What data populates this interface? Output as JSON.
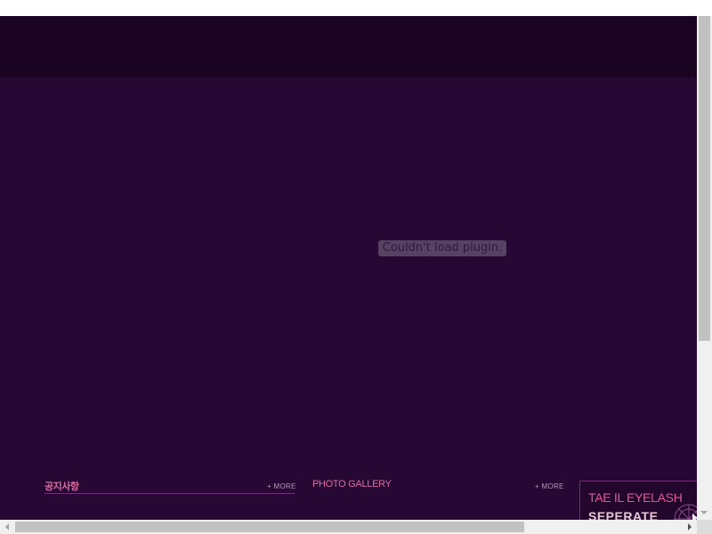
{
  "plugin": {
    "message": "Couldn't load plugin."
  },
  "notice": {
    "title": "공지사항",
    "more_label": "+ MORE"
  },
  "gallery": {
    "title": "PHOTO GALLERY",
    "more_label": "+ MORE"
  },
  "banner": {
    "line1": "TAE IL EYELASH",
    "line2": "SEPERATE"
  },
  "colors": {
    "page_background": "#270733",
    "header_band": "#1a0421",
    "accent_pink": "#d76ea2",
    "rule_purple": "#6d2f78"
  },
  "icons": {
    "scroll_up": "triangle-up",
    "scroll_down": "triangle-down",
    "scroll_left": "triangle-left",
    "scroll_right": "triangle-right",
    "banner_next": "play-arrow"
  }
}
